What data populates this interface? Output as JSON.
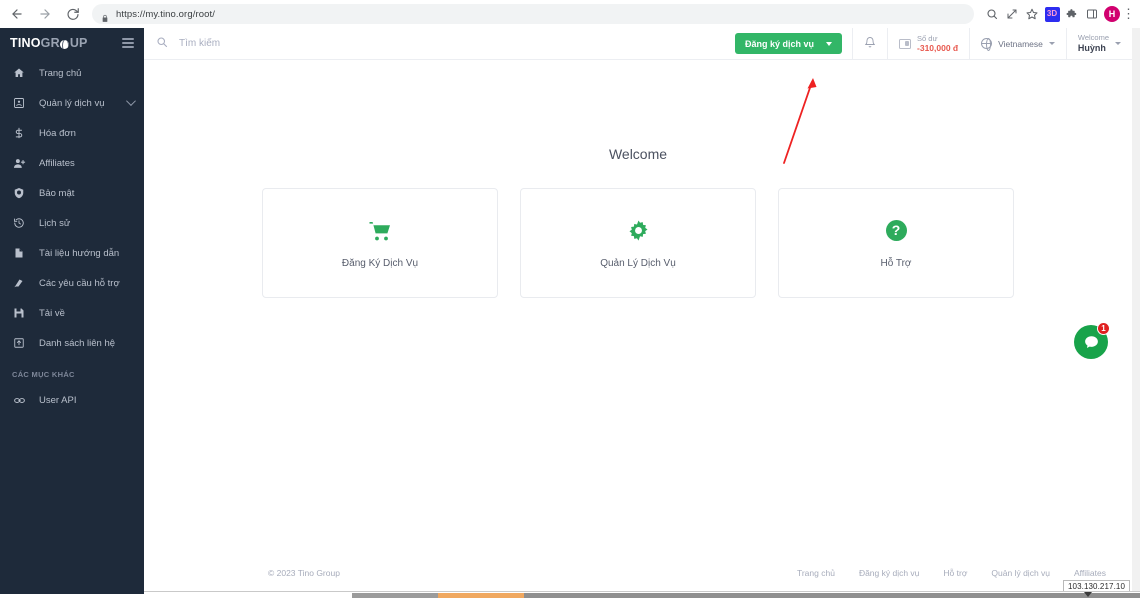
{
  "browser": {
    "url": "https://my.tino.org/root/",
    "back_icon": "back-arrow-icon",
    "forward_icon": "forward-arrow-icon",
    "reload_icon": "reload-icon",
    "lock_icon": "lock-icon",
    "search_icon": "search-icon",
    "share_icon": "share-icon",
    "bookmark_icon": "star-icon",
    "extension_badge_text": "3D",
    "extensions_icon": "puzzle-icon",
    "sidepanel_icon": "side-panel-icon",
    "profile_initial": "H",
    "menu_icon": "kebab-menu-icon"
  },
  "sidebar": {
    "logo": {
      "part1": "TINO",
      "part2": "GR",
      "part3": "UP"
    },
    "menu_toggle": "hamburger-icon",
    "items": [
      {
        "label": "Trang chủ",
        "icon": "home-icon",
        "has_chevron": false
      },
      {
        "label": "Quản lý dịch vụ",
        "icon": "services-box-icon",
        "has_chevron": true
      },
      {
        "label": "Hóa đơn",
        "icon": "dollar-icon",
        "has_chevron": false
      },
      {
        "label": "Affiliates",
        "icon": "user-plus-icon",
        "has_chevron": false
      },
      {
        "label": "Bảo mật",
        "icon": "shield-icon",
        "has_chevron": false
      },
      {
        "label": "Lịch sử",
        "icon": "history-clock-icon",
        "has_chevron": false
      },
      {
        "label": "Tài liệu hướng dẫn",
        "icon": "document-icon",
        "has_chevron": false
      },
      {
        "label": "Các yêu cầu hỗ trợ",
        "icon": "support-icon",
        "has_chevron": false
      },
      {
        "label": "Tải về",
        "icon": "save-download-icon",
        "has_chevron": false
      },
      {
        "label": "Danh sách liên hệ",
        "icon": "contact-list-icon",
        "has_chevron": false
      }
    ],
    "section_title": "CÁC MỤC KHÁC",
    "other_items": [
      {
        "label": "User API",
        "icon": "api-link-icon"
      }
    ]
  },
  "topbar": {
    "search_placeholder": "Tìm kiếm",
    "search_value": "",
    "search_icon": "search-icon",
    "register_button": "Đăng ký dịch vụ",
    "register_caret_icon": "chevron-down-icon",
    "notification_icon": "bell-icon",
    "balance_icon": "wallet-icon",
    "balance_label": "Số dư",
    "balance_value": "-310,000 đ",
    "language_icon": "globe-icon",
    "language": "Vietnamese",
    "language_caret_icon": "chevron-down-icon",
    "user_welcome": "Welcome",
    "user_name": "Huỳnh",
    "user_caret_icon": "chevron-down-icon"
  },
  "main": {
    "title": "Welcome",
    "cards": [
      {
        "label": "Đăng Ký Dịch Vụ",
        "icon": "shopping-cart-icon"
      },
      {
        "label": "Quản Lý Dịch Vụ",
        "icon": "gear-icon"
      },
      {
        "label": "Hỗ Trợ",
        "icon": "question-mark-circle-icon"
      }
    ]
  },
  "chat": {
    "icon": "chat-bubble-icon",
    "badge": "1"
  },
  "footer": {
    "copyright": "© 2023 Tino Group",
    "links": [
      "Trang chủ",
      "Đăng ký dịch vụ",
      "Hỗ trợ",
      "Quản lý dịch vụ",
      "Affiliates"
    ]
  },
  "status": {
    "ip": "103.130.217.10"
  },
  "colors": {
    "brand_green": "#32b667",
    "sidebar_bg": "#1e2a3a",
    "negative_red": "#e8594f",
    "annotation_red": "#ee2222",
    "badge_red": "#e02020"
  }
}
